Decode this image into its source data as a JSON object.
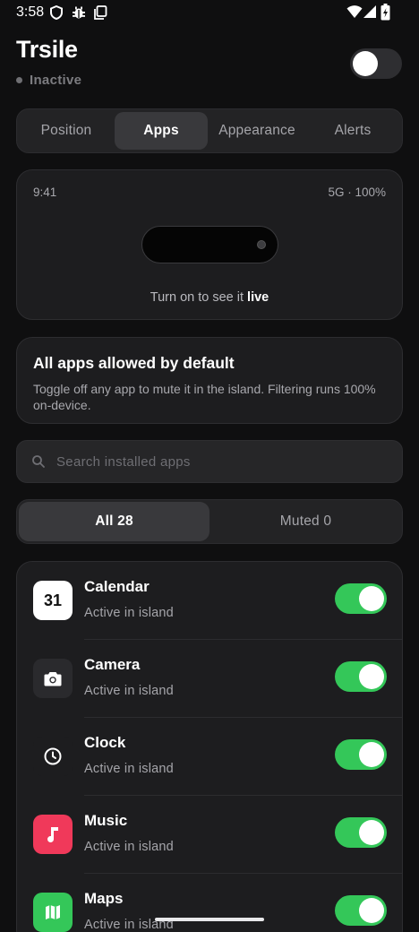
{
  "status_bar": {
    "time": "3:58",
    "icons": [
      "shield-icon",
      "bug-icon",
      "screenshot-icon",
      "wifi-icon",
      "signal-icon",
      "battery-charging-icon"
    ]
  },
  "header": {
    "title": "Trsile",
    "status": "Inactive",
    "master_enabled": false
  },
  "tabs": [
    {
      "label": "Position",
      "active": false
    },
    {
      "label": "Apps",
      "active": true
    },
    {
      "label": "Appearance",
      "active": false
    },
    {
      "label": "Alerts",
      "active": false
    }
  ],
  "preview": {
    "time": "9:41",
    "network": "5G · 100%",
    "caption_prefix": "Turn on to see it",
    "caption_emphasis": "live"
  },
  "info": {
    "title": "All apps allowed by default",
    "body": "Toggle off any app to mute it in the island. Filtering runs 100% on-device."
  },
  "search": {
    "placeholder": "Search installed apps",
    "value": ""
  },
  "filter": [
    {
      "label": "All 28",
      "active": true
    },
    {
      "label": "Muted 0",
      "active": false
    }
  ],
  "apps": [
    {
      "name": "Calendar",
      "status": "Active in island",
      "icon": "calendar-icon",
      "icon_text": "31",
      "icon_bg": "#ffffff",
      "enabled": true
    },
    {
      "name": "Camera",
      "status": "Active in island",
      "icon": "camera-icon",
      "icon_bg": "#2a2a2d",
      "enabled": true
    },
    {
      "name": "Clock",
      "status": "Active in island",
      "icon": "clock-icon",
      "icon_bg": "#1d1d1f",
      "enabled": true
    },
    {
      "name": "Music",
      "status": "Active in island",
      "icon": "music-note-icon",
      "icon_bg": "#f0395a",
      "enabled": true
    },
    {
      "name": "Maps",
      "status": "Active in island",
      "icon": "map-icon",
      "icon_bg": "#34c759",
      "enabled": true
    }
  ],
  "colors": {
    "background": "#0f0f10",
    "card": "#1d1d1f",
    "toggle_on": "#34c759",
    "toggle_off": "#2e2e31"
  }
}
